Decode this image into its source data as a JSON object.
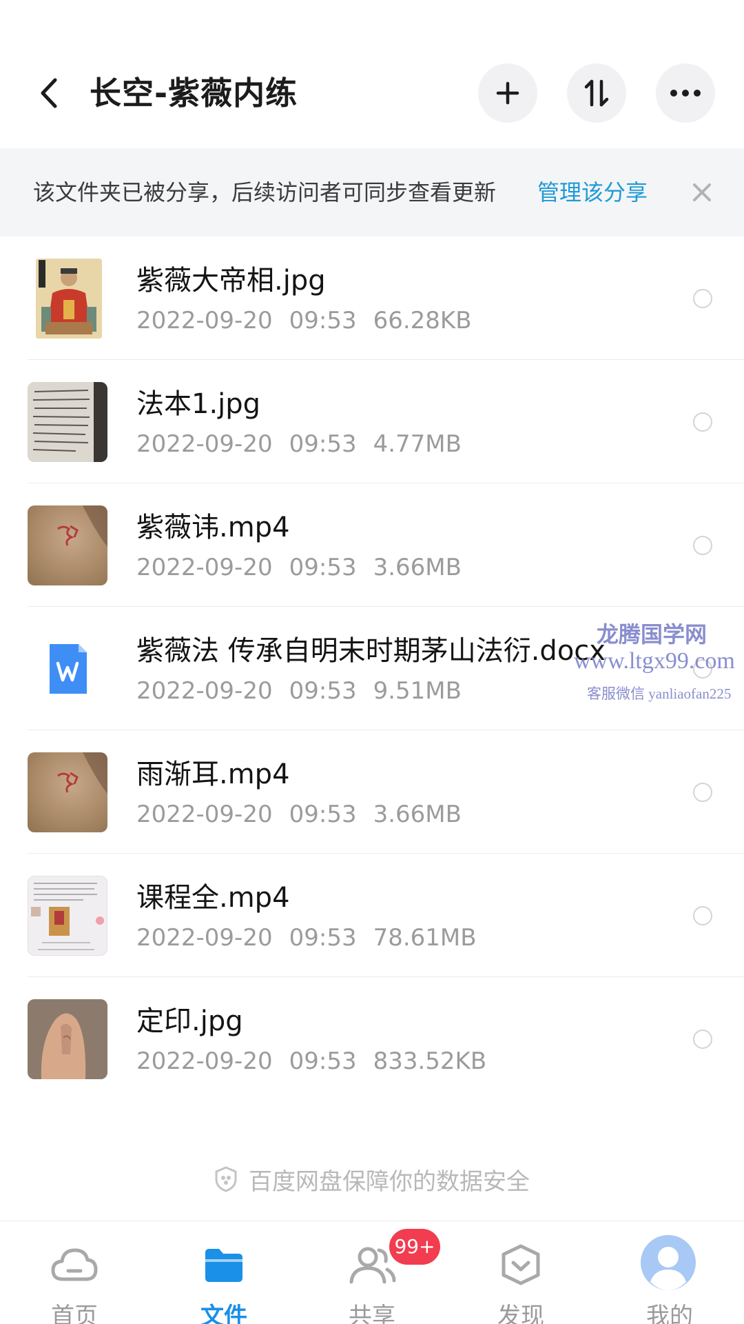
{
  "header": {
    "title": "长空-紫薇内练",
    "back_icon": "chevron-left-icon",
    "actions": [
      {
        "name": "add",
        "icon": "plus-icon"
      },
      {
        "name": "sort",
        "icon": "sort-icon"
      },
      {
        "name": "more",
        "icon": "more-dots-icon"
      }
    ]
  },
  "share_banner": {
    "text": "该文件夹已被分享，后续访问者可同步查看更新",
    "link": "管理该分享",
    "close_icon": "close-icon",
    "link_color": "#1f9ad6"
  },
  "files": [
    {
      "name": "紫薇大帝相.jpg",
      "date": "2022-09-20",
      "time": "09:53",
      "size": "66.28KB",
      "thumb": "painting"
    },
    {
      "name": "法本1.jpg",
      "date": "2022-09-20",
      "time": "09:53",
      "size": "4.77MB",
      "thumb": "handwritten-paper"
    },
    {
      "name": "紫薇讳.mp4",
      "date": "2022-09-20",
      "time": "09:53",
      "size": "3.66MB",
      "thumb": "video"
    },
    {
      "name": "紫薇法 传承自明末时期茅山法衍.docx",
      "date": "2022-09-20",
      "time": "09:53",
      "size": "9.51MB",
      "thumb": "word-doc-icon"
    },
    {
      "name": "雨渐耳.mp4",
      "date": "2022-09-20",
      "time": "09:53",
      "size": "3.66MB",
      "thumb": "video"
    },
    {
      "name": "课程全.mp4",
      "date": "2022-09-20",
      "time": "09:53",
      "size": "78.61MB",
      "thumb": "screenshot"
    },
    {
      "name": "定印.jpg",
      "date": "2022-09-20",
      "time": "09:53",
      "size": "833.52KB",
      "thumb": "hand-photo"
    }
  ],
  "watermark": {
    "title": "龙腾国学网",
    "url": "www.ltgx99.com",
    "contact": "客服微信 yanliaofan225"
  },
  "security_note": {
    "text": "百度网盘保障你的数据安全",
    "icon": "shield-icon"
  },
  "bottom_nav": {
    "items": [
      {
        "label": "首页",
        "icon": "cloud-icon",
        "active": false
      },
      {
        "label": "文件",
        "icon": "folder-icon",
        "active": true
      },
      {
        "label": "共享",
        "icon": "people-icon",
        "active": false
      },
      {
        "label": "发现",
        "icon": "discover-icon",
        "active": false
      },
      {
        "label": "我的",
        "icon": "avatar-icon",
        "active": false
      }
    ],
    "badge": "99+",
    "active_color": "#1a90e8",
    "badge_color": "#f23c4f"
  }
}
